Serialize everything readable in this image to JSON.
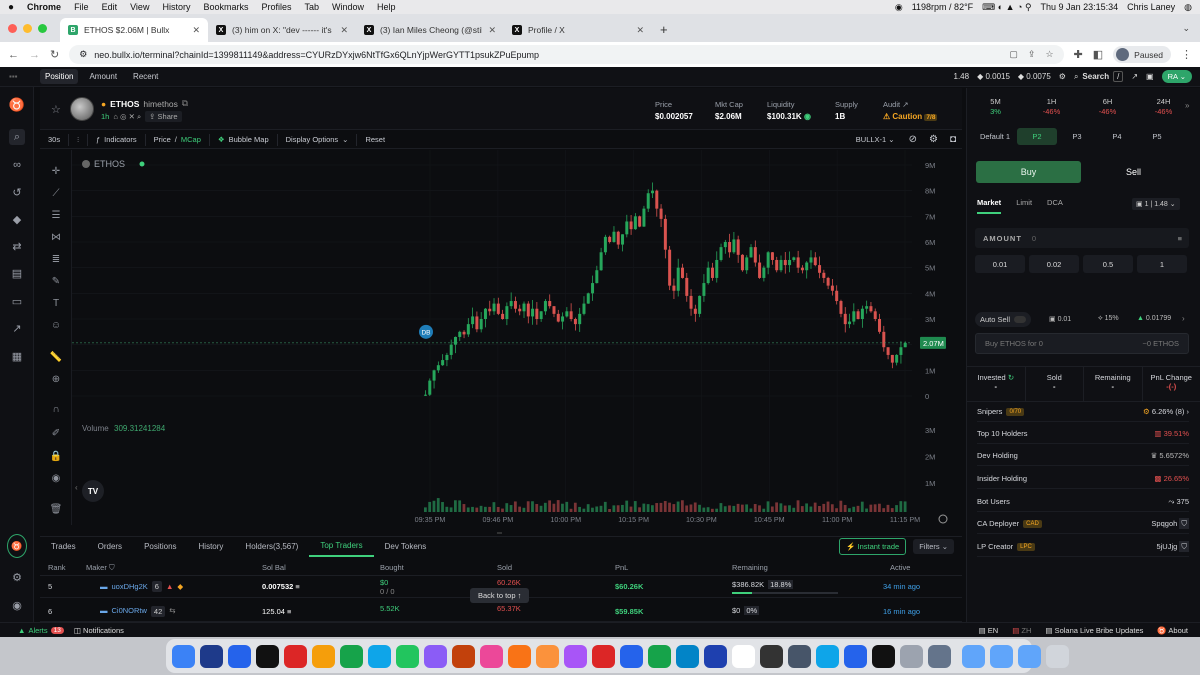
{
  "menubar": {
    "apple": "",
    "items": [
      "Chrome",
      "File",
      "Edit",
      "View",
      "History",
      "Bookmarks",
      "Profiles",
      "Tab",
      "Window",
      "Help"
    ],
    "fan": "1198rpm / 82°F",
    "datetime": "Thu 9 Jan  23:15:34",
    "user": "Chris Laney"
  },
  "browser": {
    "tabs": [
      {
        "title": "ETHOS $2.06M | Bullx",
        "fav": "B",
        "color": "#2ea56a"
      },
      {
        "title": "(3) him on X: \"dev ------ it's o\"",
        "fav": "X",
        "color": "#000"
      },
      {
        "title": "(3) Ian Miles Cheong (@stillgr",
        "fav": "X",
        "color": "#000"
      },
      {
        "title": "Profile / X",
        "fav": "X",
        "color": "#000"
      }
    ],
    "url": "neo.bullx.io/terminal?chainId=1399811149&address=CYURzDYxjw6NtTfGx6QLnYjpWerGYTT1psukZPuEpump",
    "paused": "Paused"
  },
  "apptop": {
    "tabs": [
      "Position",
      "Amount",
      "Recent"
    ],
    "price_vals": [
      "1.48",
      "0.0015",
      "0.0075"
    ],
    "search": "Search",
    "search_key": "/",
    "user": "RA"
  },
  "token": {
    "name": "ETHOS",
    "handle": "himethos",
    "age": "1h",
    "share": "Share",
    "stats": [
      {
        "label": "Price",
        "value": "$0.002057"
      },
      {
        "label": "Mkt Cap",
        "value": "$2.06M"
      },
      {
        "label": "Liquidity",
        "value": "$100.31K"
      },
      {
        "label": "Supply",
        "value": "1B"
      },
      {
        "label": "Audit",
        "value": "Caution",
        "badge": "7/8"
      }
    ]
  },
  "toolbar": {
    "interval": "30s",
    "indicators": "Indicators",
    "price": "Price",
    "mcap": "MCap",
    "bubble": "Bubble Map",
    "display": "Display Options",
    "reset": "Reset",
    "bullx": "BULLX-1"
  },
  "chart_data": {
    "type": "candlestick",
    "title": "ETHOS",
    "price_label": "2.07M",
    "db_marker": "DB",
    "volume_label": "Volume",
    "volume_value": "309.31241284",
    "y_ticks": [
      "9M",
      "8M",
      "7M",
      "6M",
      "5M",
      "4M",
      "3M",
      "2M",
      "1M",
      "0"
    ],
    "vol_ticks": [
      "3M",
      "2M",
      "1M"
    ],
    "x_ticks": [
      "09:35 PM",
      "09:46 PM",
      "10:00 PM",
      "10:15 PM",
      "10:30 PM",
      "10:45 PM",
      "11:00 PM",
      "11:15 PM"
    ],
    "ylim": [
      0,
      9
    ],
    "unit": "M",
    "close_series": [
      0.05,
      0.6,
      1.0,
      1.2,
      1.4,
      1.6,
      2.0,
      2.3,
      2.5,
      2.4,
      2.8,
      3.1,
      2.6,
      3.0,
      3.4,
      3.3,
      3.6,
      3.2,
      3.0,
      3.5,
      3.7,
      3.4,
      3.3,
      3.6,
      3.1,
      3.4,
      3.0,
      3.3,
      3.7,
      3.5,
      3.2,
      2.9,
      3.1,
      3.3,
      3.0,
      2.8,
      3.2,
      3.6,
      4.0,
      4.4,
      4.9,
      5.6,
      6.2,
      6.0,
      6.4,
      5.9,
      6.3,
      6.8,
      6.5,
      7.0,
      6.6,
      7.3,
      7.9,
      8.0,
      7.3,
      6.9,
      5.7,
      4.3,
      4.1,
      5.0,
      4.6,
      3.9,
      3.4,
      3.2,
      3.9,
      4.4,
      5.0,
      4.6,
      5.3,
      5.8,
      6.0,
      5.6,
      6.1,
      5.5,
      4.9,
      5.4,
      5.8,
      5.2,
      4.6,
      5.0,
      5.6,
      5.3,
      4.9,
      5.3,
      5.1,
      5.3,
      5.4,
      5.0,
      4.9,
      5.2,
      5.4,
      5.1,
      4.8,
      4.6,
      4.3,
      4.1,
      3.7,
      3.2,
      2.8,
      2.9,
      3.3,
      3.0,
      3.4,
      3.5,
      3.3,
      3.0,
      2.5,
      1.9,
      1.6,
      1.3,
      1.6,
      1.9,
      2.07
    ],
    "current": 2.07
  },
  "bottom": {
    "tabs": [
      "Trades",
      "Orders",
      "Positions",
      "History",
      "Holders(3,567)",
      "Top Traders",
      "Dev Tokens"
    ],
    "active": 5,
    "instant": "Instant trade",
    "filters": "Filters",
    "headers": [
      "Rank",
      "Maker",
      "Sol Bal",
      "Bought",
      "Sold",
      "PnL",
      "Remaining",
      "Active"
    ],
    "rows": [
      {
        "rank": "5",
        "maker": "uoxDHg2K",
        "count": "6",
        "sol": "0.007532",
        "bought": "$0",
        "bought2": "0 / 0",
        "sold": "60.26K",
        "pnl": "$60.26K",
        "remaining": "$386.82K",
        "rem_pct": "18.8%",
        "rem_fill": 0.188,
        "active": "34 min ago"
      },
      {
        "rank": "6",
        "maker": "Ci0NORtw",
        "count": "42",
        "sol": "125.04",
        "bought": "5.52K",
        "bought2": "",
        "sold": "65.37K",
        "pnl": "$59.85K",
        "remaining": "$0",
        "rem_pct": "0%",
        "rem_fill": 0,
        "active": "16 min ago"
      }
    ],
    "back_to_top": "Back to top"
  },
  "right": {
    "timeframes": [
      {
        "tf": "5M",
        "pct": "3%",
        "dir": "pos"
      },
      {
        "tf": "1H",
        "pct": "-46%",
        "dir": "neg"
      },
      {
        "tf": "6H",
        "pct": "-46%",
        "dir": "neg"
      },
      {
        "tf": "24H",
        "pct": "-46%",
        "dir": "neg"
      }
    ],
    "presets": [
      "Default 1",
      "P2",
      "P3",
      "P4",
      "P5"
    ],
    "buy": "Buy",
    "sell": "Sell",
    "order_tabs": [
      "Market",
      "Limit",
      "DCA"
    ],
    "wallet": "1",
    "wallet_bal": "1.48",
    "amount_label": "AMOUNT",
    "amount_value": "0",
    "quick": [
      "0.01",
      "0.02",
      "0.5",
      "1"
    ],
    "auto_sell": "Auto Sell",
    "fee": "0.01",
    "slip": "15%",
    "tip": "0.01799",
    "buy_for": "Buy ETHOS for 0",
    "receive": "~0 ETHOS",
    "pos_heads": [
      "Invested",
      "Sold",
      "Remaining",
      "PnL Change"
    ],
    "pos_vals": [
      "-",
      "-",
      "-",
      "-(-)"
    ],
    "metrics": [
      {
        "label": "Snipers",
        "tag": "0/70",
        "value": "6.26% (8)",
        "color": "#ddd"
      },
      {
        "label": "Top 10 Holders",
        "tag": "",
        "value": "39.51%",
        "color": "#e2504f"
      },
      {
        "label": "Dev Holding",
        "tag": "",
        "value": "5.6572%",
        "color": "#bbb"
      },
      {
        "label": "Insider Holding",
        "tag": "",
        "value": "26.65%",
        "color": "#e2504f"
      },
      {
        "label": "Bot Users",
        "tag": "",
        "value": "375",
        "color": "#ddd"
      },
      {
        "label": "CA Deployer",
        "tag": "CAD",
        "value": "Spqgoh",
        "color": "#ddd"
      },
      {
        "label": "LP Creator",
        "tag": "LPC",
        "value": "5jUJjg",
        "color": "#ddd"
      }
    ]
  },
  "statusbar": {
    "alerts": "Alerts",
    "alert_count": "13",
    "notifications": "Notifications",
    "lang": "EN",
    "lang2": "ZH",
    "bribe": "Solana Live Bribe Updates",
    "about": "About"
  }
}
